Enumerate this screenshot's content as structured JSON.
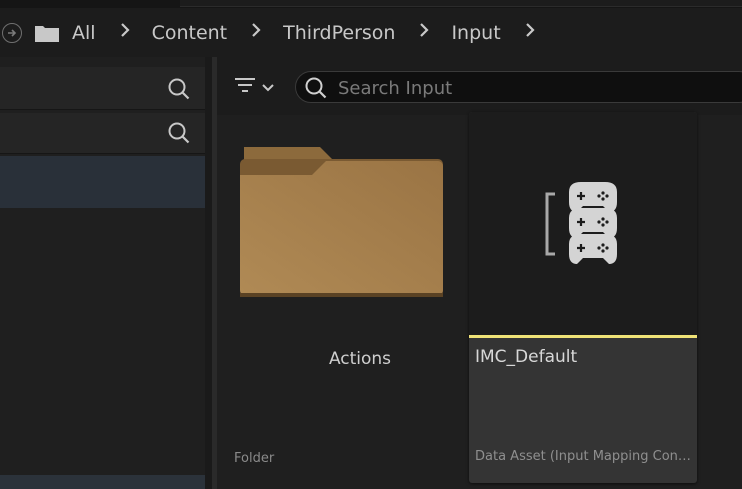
{
  "breadcrumb": {
    "items": [
      "All",
      "Content",
      "ThirdPerson",
      "Input"
    ]
  },
  "toolbar": {
    "search_placeholder": "Search Input"
  },
  "assets": [
    {
      "name": "Actions",
      "type": "Folder",
      "icon": "folder-icon"
    },
    {
      "name": "IMC_Default",
      "type": "Data Asset (Input Mapping Context)",
      "icon": "input-mapping-context-icon",
      "accent_color": "#efe277"
    }
  ],
  "colors": {
    "background": "#1a1a1a",
    "panel": "#252525",
    "selection": "#293039",
    "folder": "#a87c4a",
    "asset_accent": "#efe277"
  }
}
